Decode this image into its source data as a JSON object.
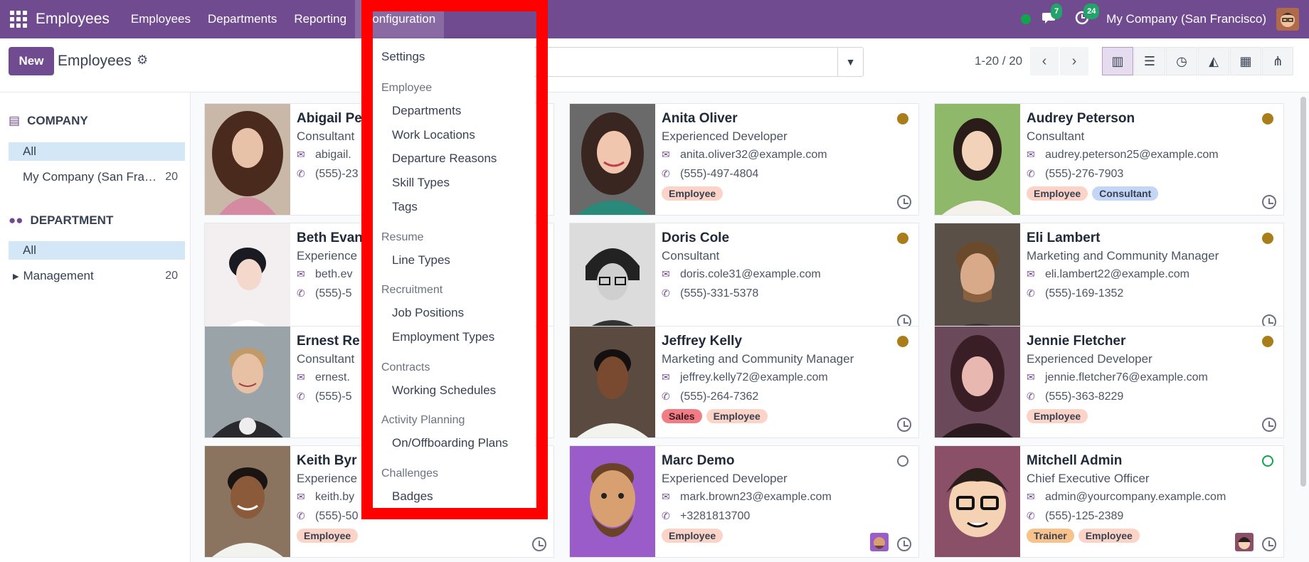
{
  "navbar": {
    "app_name": "Employees",
    "menu": [
      "Employees",
      "Departments",
      "Reporting",
      "Configuration"
    ],
    "messages_count": "7",
    "activities_count": "24",
    "company": "My Company (San Francisco)"
  },
  "control": {
    "new_label": "New",
    "title": "Employees",
    "pager": "1-20 / 20"
  },
  "sidebar": {
    "company_heading": "COMPANY",
    "company_items": [
      {
        "label": "All",
        "count": ""
      },
      {
        "label": "My Company (San Fra…",
        "count": "20"
      }
    ],
    "department_heading": "DEPARTMENT",
    "department_items": [
      {
        "label": "All",
        "count": ""
      },
      {
        "label": "Management",
        "count": "20"
      }
    ]
  },
  "config_menu": {
    "settings": "Settings",
    "employee_heading": "Employee",
    "employee_items": [
      "Departments",
      "Work Locations",
      "Departure Reasons",
      "Skill Types",
      "Tags"
    ],
    "resume_heading": "Resume",
    "resume_items": [
      "Line Types"
    ],
    "recruitment_heading": "Recruitment",
    "recruitment_items": [
      "Job Positions",
      "Employment Types"
    ],
    "contracts_heading": "Contracts",
    "contracts_items": [
      "Working Schedules"
    ],
    "activity_heading": "Activity Planning",
    "activity_items": [
      "On/Offboarding Plans"
    ],
    "challenges_heading": "Challenges",
    "challenges_items": [
      "Badges"
    ]
  },
  "employees": [
    {
      "name": "Abigail Pe",
      "job": "Consultant",
      "email": "abigail.",
      "phone": "(555)-23",
      "tags": []
    },
    {
      "name": "Anita Oliver",
      "job": "Experienced Developer",
      "email": "anita.oliver32@example.com",
      "phone": "(555)-497-4804",
      "tags": [
        "Employee"
      ]
    },
    {
      "name": "Audrey Peterson",
      "job": "Consultant",
      "email": "audrey.peterson25@example.com",
      "phone": "(555)-276-7903",
      "tags": [
        "Employee",
        "Consultant"
      ]
    },
    {
      "name": "Beth Evan",
      "job": "Experience",
      "email": "beth.ev",
      "phone": "(555)-5",
      "tags": []
    },
    {
      "name": "Doris Cole",
      "job": "Consultant",
      "email": "doris.cole31@example.com",
      "phone": "(555)-331-5378",
      "tags": []
    },
    {
      "name": "Eli Lambert",
      "job": "Marketing and Community Manager",
      "email": "eli.lambert22@example.com",
      "phone": "(555)-169-1352",
      "tags": []
    },
    {
      "name": "Ernest Re",
      "job": "Consultant",
      "email": "ernest.",
      "phone": "(555)-5",
      "tags": []
    },
    {
      "name": "Jeffrey Kelly",
      "job": "Marketing and Community Manager",
      "email": "jeffrey.kelly72@example.com",
      "phone": "(555)-264-7362",
      "tags": [
        "Sales",
        "Employee"
      ]
    },
    {
      "name": "Jennie Fletcher",
      "job": "Experienced Developer",
      "email": "jennie.fletcher76@example.com",
      "phone": "(555)-363-8229",
      "tags": [
        "Employee"
      ]
    },
    {
      "name": "Keith Byr",
      "job": "Experience",
      "email": "keith.by",
      "phone": "(555)-50",
      "tags": [
        "Employee"
      ]
    },
    {
      "name": "Marc Demo",
      "job": "Experienced Developer",
      "email": "mark.brown23@example.com",
      "phone": "+3281813700",
      "tags": [
        "Employee"
      ]
    },
    {
      "name": "Mitchell Admin",
      "job": "Chief Executive Officer",
      "email": "admin@yourcompany.example.com",
      "phone": "(555)-125-2389",
      "tags": [
        "Trainer",
        "Employee"
      ]
    }
  ],
  "colors": {
    "brand": "#714b8f",
    "status_away": "#a97d1a",
    "status_online": "#10a54a",
    "highlight": "#ff0000"
  }
}
